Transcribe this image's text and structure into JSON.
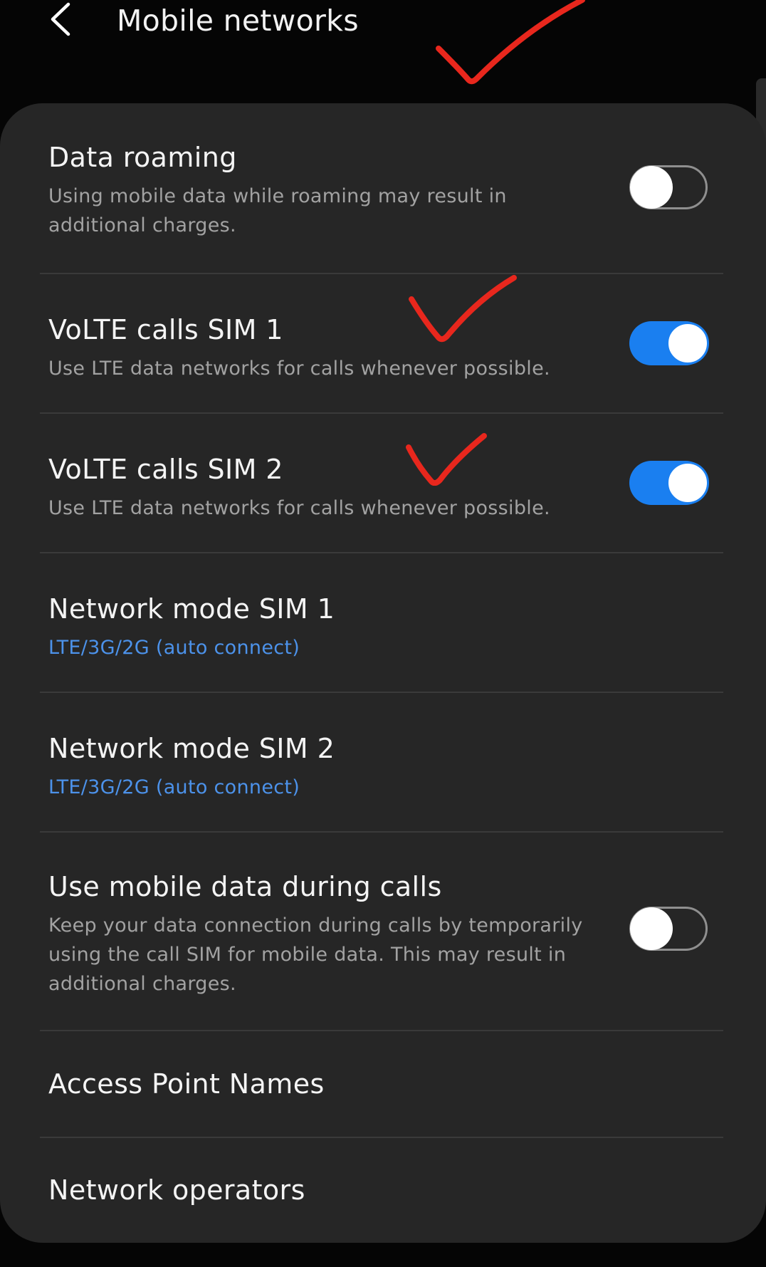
{
  "header": {
    "title": "Mobile networks",
    "back_icon": "chevron-left-icon"
  },
  "colors": {
    "background": "#050505",
    "card": "#262626",
    "divider": "#3a3a3a",
    "accent_blue": "#1a7ff0",
    "link_blue": "#4c92ea",
    "annotation_red": "#e8271d"
  },
  "settings": [
    {
      "id": "data_roaming",
      "title": "Data roaming",
      "subtitle": "Using mobile data while roaming may result in additional charges.",
      "toggle": "off"
    },
    {
      "id": "volte_sim1",
      "title": "VoLTE calls SIM 1",
      "subtitle": "Use LTE data networks for calls whenever possible.",
      "toggle": "on"
    },
    {
      "id": "volte_sim2",
      "title": "VoLTE calls SIM 2",
      "subtitle": "Use LTE data networks for calls whenever possible.",
      "toggle": "on"
    },
    {
      "id": "network_mode_sim1",
      "title": "Network mode SIM 1",
      "subtitle": "LTE/3G/2G (auto connect)"
    },
    {
      "id": "network_mode_sim2",
      "title": "Network mode SIM 2",
      "subtitle": "LTE/3G/2G (auto connect)"
    },
    {
      "id": "mobile_data_calls",
      "title": "Use mobile data during calls",
      "subtitle": "Keep your data connection during calls by temporarily using the call SIM for mobile data. This may result in additional charges.",
      "toggle": "off"
    },
    {
      "id": "apn",
      "title": "Access Point Names"
    },
    {
      "id": "network_operators",
      "title": "Network operators"
    }
  ],
  "annotations": {
    "mark_icon": "checkmark-icon"
  }
}
